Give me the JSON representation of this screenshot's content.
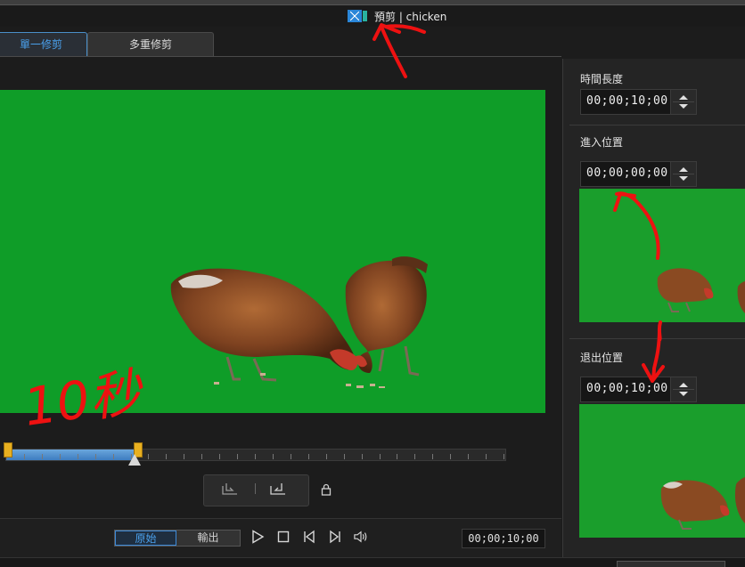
{
  "title_bar": {
    "title": "預剪 | chicken",
    "icon": "video-clip-icon"
  },
  "tabs": [
    {
      "label": "單一修剪",
      "active": true
    },
    {
      "label": "多重修剪",
      "active": false
    }
  ],
  "timeline": {
    "progress": 0.26,
    "colors": {
      "fill": "#4a8fd0",
      "handle": "#e8b020"
    }
  },
  "mark_buttons": {
    "mark_in_icon": "mark-in-icon",
    "mark_out_icon": "mark-out-icon",
    "lock_icon": "lock-icon"
  },
  "playback": {
    "segment": {
      "source_label": "原始",
      "output_label": "輸出"
    },
    "controls": [
      "play-icon",
      "stop-icon",
      "prev-frame-icon",
      "next-frame-icon",
      "volume-icon"
    ],
    "time": "00;00;10;00"
  },
  "right_panel": {
    "duration": {
      "label": "時間長度",
      "value": "00;00;10;00"
    },
    "in_point": {
      "label": "進入位置",
      "value": "00;00;00;00"
    },
    "out_point": {
      "label": "退出位置",
      "value": "00;00;10;00"
    }
  },
  "annotation": {
    "handwritten_text": "10秒",
    "color": "#ee1111"
  },
  "colors": {
    "accent": "#4aa0ec",
    "green_screen": "#0f9d28",
    "panel": "#242424"
  }
}
